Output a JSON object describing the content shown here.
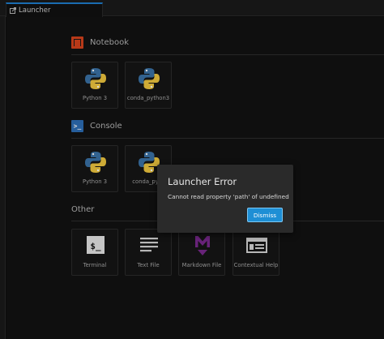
{
  "tab": {
    "title": "Launcher",
    "icon": "launcher-icon"
  },
  "sections": {
    "notebook": {
      "title": "Notebook",
      "icon": "notebook-icon"
    },
    "console": {
      "title": "Console",
      "icon": "console-icon"
    },
    "other": {
      "title": "Other"
    }
  },
  "notebook_cards": [
    {
      "label": "Python 3",
      "icon": "python-icon"
    },
    {
      "label": "conda_python3",
      "icon": "python-icon"
    }
  ],
  "console_cards": [
    {
      "label": "Python 3",
      "icon": "python-icon"
    },
    {
      "label": "conda_pyth",
      "icon": "python-icon"
    }
  ],
  "other_cards": [
    {
      "label": "Terminal",
      "icon": "terminal-icon"
    },
    {
      "label": "Text File",
      "icon": "text-file-icon"
    },
    {
      "label": "Markdown File",
      "icon": "markdown-icon"
    },
    {
      "label": "Contextual Help",
      "icon": "contextual-help-icon"
    }
  ],
  "dialog": {
    "title": "Launcher Error",
    "message": "Cannot read property 'path' of undefined",
    "dismiss_label": "Dismiss"
  },
  "colors": {
    "accent": "#1e8fd5",
    "notebook": "#d9431d",
    "console": "#2d6fb8",
    "markdown": "#7b2a8f",
    "python_blue": "#3b74a8",
    "python_yellow": "#f3c940"
  }
}
